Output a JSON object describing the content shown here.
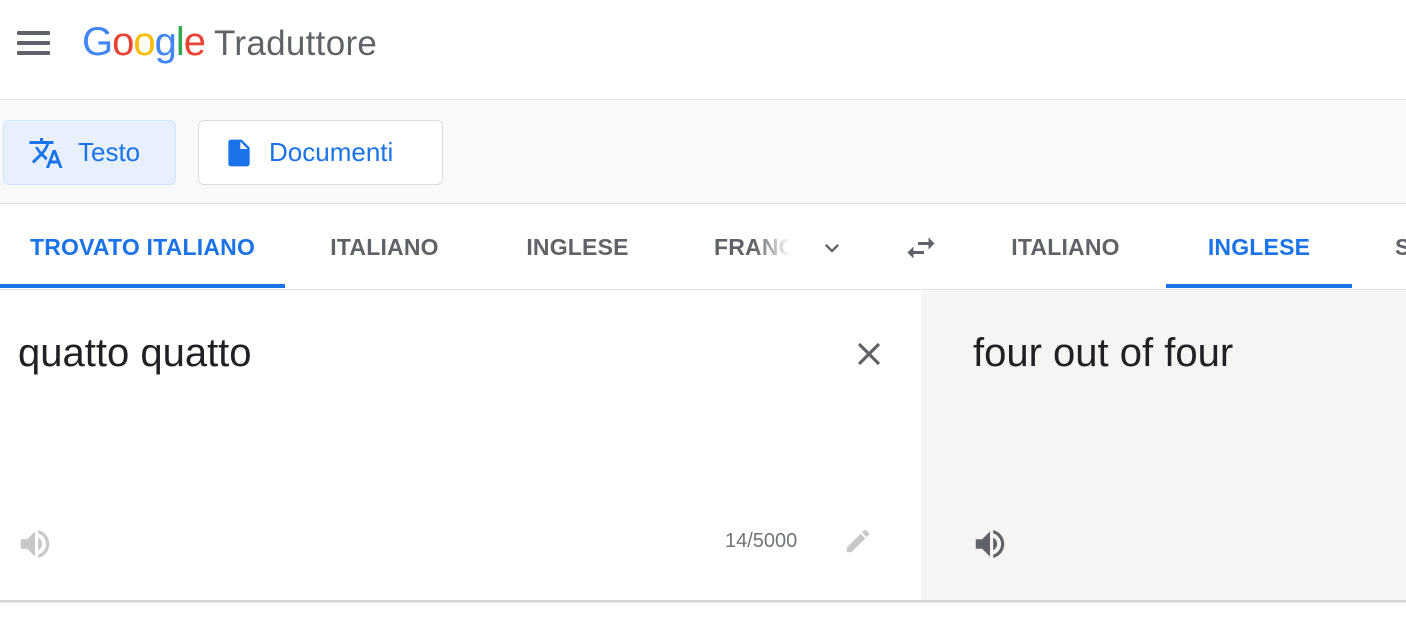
{
  "header": {
    "logo_letters": [
      "G",
      "o",
      "o",
      "g",
      "l",
      "e"
    ],
    "logo_colors": [
      "#4285f4",
      "#ea4335",
      "#fbbc05",
      "#4285f4",
      "#34a853",
      "#ea4335"
    ],
    "app_name": "Traduttore",
    "menu_icon": "hamburger-menu-icon"
  },
  "modes": {
    "text": {
      "label": "Testo",
      "icon": "translate-icon"
    },
    "documents": {
      "label": "Documenti",
      "icon": "document-icon"
    }
  },
  "source_languages": {
    "detected": "TROVATO ITALIANO",
    "items": [
      "ITALIANO",
      "INGLESE",
      "FRANCESE"
    ],
    "more_icon": "chevron-down-icon"
  },
  "swap_icon": "swap-arrows-icon",
  "target_languages": {
    "items": [
      "ITALIANO",
      "INGLESE",
      "SPAGNOLO"
    ],
    "selected": "INGLESE"
  },
  "source": {
    "text": "quatto quatto",
    "char_count": "14/5000",
    "clear_icon": "close-icon",
    "listen_icon": "speaker-icon",
    "edit_icon": "pencil-icon"
  },
  "target": {
    "text": "four out of four",
    "listen_icon": "speaker-icon"
  },
  "colors": {
    "accent": "#1a73e8",
    "active_mode_bg": "#e8f0fe",
    "target_panel_bg": "#f5f5f5",
    "tab_text": "#5f6368"
  }
}
